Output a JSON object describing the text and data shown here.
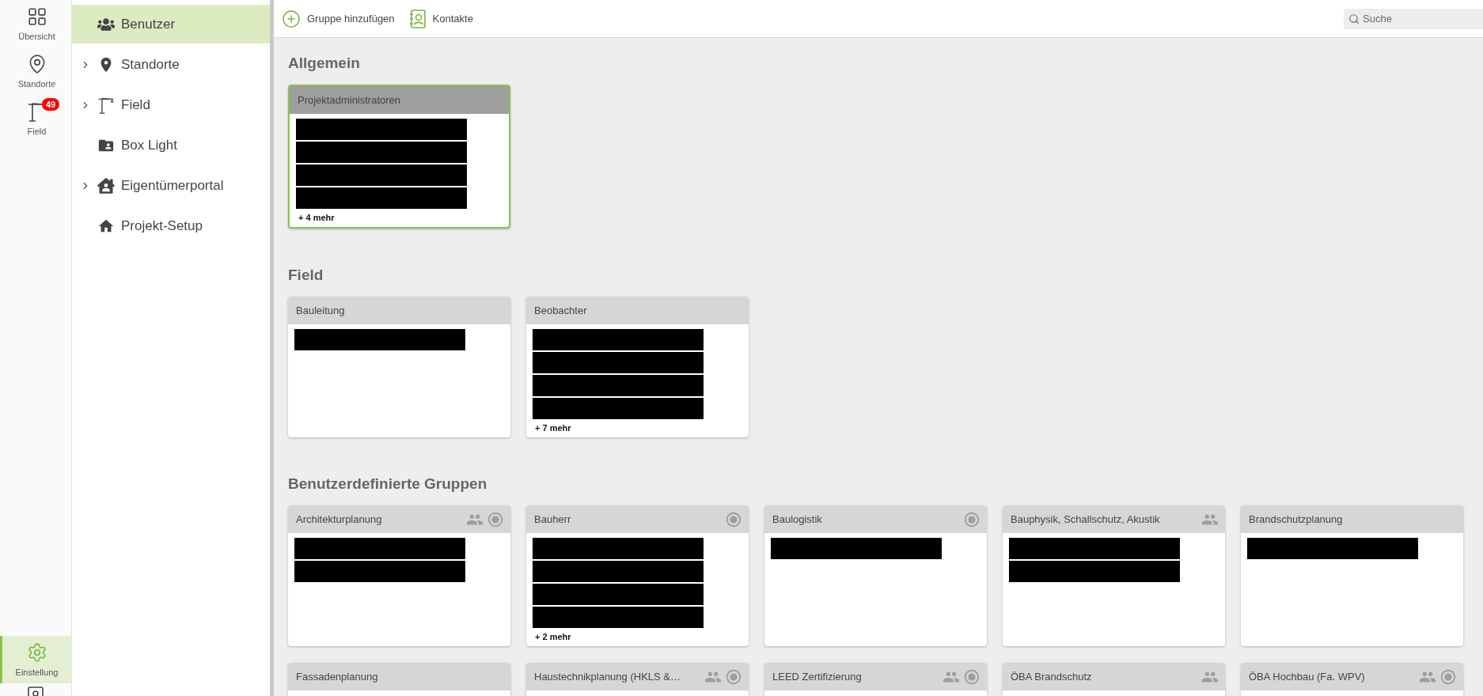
{
  "rail": {
    "items": [
      {
        "label": "Übersicht",
        "kind": "grid",
        "selected": false
      },
      {
        "label": "Standorte",
        "kind": "pin",
        "selected": false
      },
      {
        "label": "Field",
        "kind": "crane",
        "badge": "49",
        "selected": false
      }
    ],
    "bottom_items": [
      {
        "label": "Einstellung",
        "kind": "gear",
        "selected": true
      }
    ]
  },
  "sidebar": {
    "items": [
      {
        "label": "Benutzer",
        "kind": "users",
        "selected": true,
        "expandable": false
      },
      {
        "label": "Standorte",
        "kind": "pin",
        "selected": false,
        "expandable": true
      },
      {
        "label": "Field",
        "kind": "crane",
        "selected": false,
        "expandable": true
      },
      {
        "label": "Box Light",
        "kind": "folder",
        "selected": false,
        "expandable": false
      },
      {
        "label": "Eigentümerportal",
        "kind": "house-user",
        "selected": false,
        "expandable": true
      },
      {
        "label": "Projekt-Setup",
        "kind": "house",
        "selected": false,
        "expandable": false
      }
    ]
  },
  "toolbar": {
    "buttons": [
      {
        "label": "Gruppe hinzufügen",
        "kind": "add"
      },
      {
        "label": "Kontakte",
        "kind": "contacts"
      }
    ],
    "search": {
      "placeholder": "Suche"
    }
  },
  "sections": [
    {
      "title": "Allgemein",
      "groups": [
        {
          "name": "Projektadministratoren",
          "selected": true,
          "shared": false,
          "radio": false,
          "members": [
            {
              "redacted": true
            },
            {
              "redacted": true
            },
            {
              "redacted": true
            },
            {
              "redacted": true
            }
          ],
          "more": "+ 4 mehr"
        }
      ]
    },
    {
      "title": "Field",
      "groups": [
        {
          "name": "Bauleitung",
          "selected": false,
          "shared": false,
          "radio": false,
          "members": [
            {
              "redacted": true
            }
          ]
        },
        {
          "name": "Beobachter",
          "selected": false,
          "shared": false,
          "radio": false,
          "members": [
            {
              "redacted": true
            },
            {
              "redacted": true
            },
            {
              "redacted": true
            },
            {
              "redacted": true
            }
          ],
          "more": "+ 7 mehr"
        }
      ]
    },
    {
      "title": "Benutzerdefinierte Gruppen",
      "groups": [
        {
          "name": "Architekturplanung",
          "selected": false,
          "shared": true,
          "radio": true,
          "members": [
            {
              "redacted": true
            },
            {
              "redacted": true
            }
          ]
        },
        {
          "name": "Bauherr",
          "selected": false,
          "shared": false,
          "radio": true,
          "members": [
            {
              "redacted": true
            },
            {
              "redacted": true
            },
            {
              "redacted": true
            },
            {
              "redacted": true
            }
          ],
          "more": "+ 2 mehr"
        },
        {
          "name": "Baulogistik",
          "selected": false,
          "shared": false,
          "radio": true,
          "members": [
            {
              "redacted": true
            }
          ]
        },
        {
          "name": "Bauphysik, Schallschutz, Akustik",
          "selected": false,
          "shared": true,
          "radio": false,
          "members": [
            {
              "redacted": true
            },
            {
              "redacted": true
            }
          ]
        },
        {
          "name": "Brandschutzplanung",
          "selected": false,
          "shared": false,
          "radio": false,
          "members": [
            {
              "redacted": true
            }
          ]
        },
        {
          "name": "Fassadenplanung",
          "selected": false,
          "shared": false,
          "radio": false
        },
        {
          "name": "Haustechnikplanung (HKLS &…",
          "selected": false,
          "shared": true,
          "radio": true
        },
        {
          "name": "LEED Zertifizierung",
          "selected": false,
          "shared": true,
          "radio": true
        },
        {
          "name": "ÖBA Brandschutz",
          "selected": false,
          "shared": true,
          "radio": false
        },
        {
          "name": "ÖBA Hochbau (Fa. WPV)",
          "selected": false,
          "shared": true,
          "radio": true
        }
      ]
    }
  ]
}
